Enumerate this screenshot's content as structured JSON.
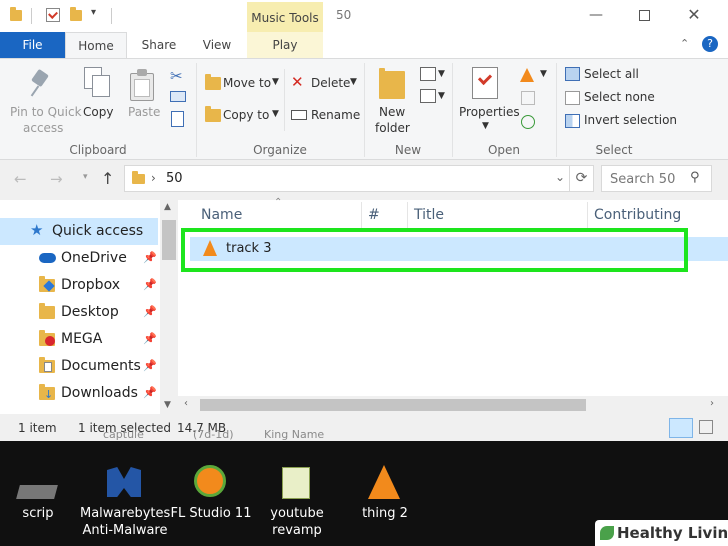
{
  "window": {
    "title": "50",
    "contextual_tab_group": "Music Tools",
    "tabs": [
      "File",
      "Home",
      "Share",
      "View",
      "Play"
    ]
  },
  "ribbon": {
    "clipboard": {
      "pin_label_line1": "Pin to Quick",
      "pin_label_line2": "access",
      "copy_label": "Copy",
      "paste_label": "Paste",
      "group_label": "Clipboard"
    },
    "organize": {
      "move_to_label": "Move to",
      "copy_to_label": "Copy to",
      "delete_label": "Delete",
      "rename_label": "Rename",
      "group_label": "Organize"
    },
    "new": {
      "new_folder_line1": "New",
      "new_folder_line2": "folder",
      "group_label": "New"
    },
    "open": {
      "properties_label": "Properties",
      "group_label": "Open"
    },
    "select": {
      "select_all_label": "Select all",
      "select_none_label": "Select none",
      "invert_selection_label": "Invert selection",
      "group_label": "Select"
    }
  },
  "address": {
    "path_segment": "50",
    "search_placeholder": "Search 50"
  },
  "nav_pane": {
    "items": [
      {
        "label": "Quick access",
        "icon": "star-icon",
        "pinned": false
      },
      {
        "label": "OneDrive",
        "icon": "cloud-icon",
        "pinned": true
      },
      {
        "label": "Dropbox",
        "icon": "dropbox-icon",
        "pinned": true
      },
      {
        "label": "Desktop",
        "icon": "folder-icon",
        "pinned": true
      },
      {
        "label": "MEGA",
        "icon": "mega-icon",
        "pinned": true
      },
      {
        "label": "Documents",
        "icon": "documents-icon",
        "pinned": true
      },
      {
        "label": "Downloads",
        "icon": "downloads-icon",
        "pinned": true
      }
    ]
  },
  "file_list": {
    "columns": [
      "Name",
      "#",
      "Title",
      "Contributing artists"
    ],
    "rows": [
      {
        "name": "track 3",
        "icon": "vlc-cone-icon",
        "selected": true
      }
    ]
  },
  "status": {
    "item_count": "1 item",
    "selection": "1 item selected",
    "size": "14.7 MB"
  },
  "desktop": {
    "ghost_labels": [
      "captule",
      "(7d-1d)",
      "King Name"
    ],
    "icons": [
      {
        "label_line1": "scrip",
        "label_line2": "",
        "icon": "scrip-icon"
      },
      {
        "label_line1": "Malwarebytes",
        "label_line2": "Anti-Malware",
        "icon": "malwarebytes-icon"
      },
      {
        "label_line1": "FL Studio 11",
        "label_line2": "",
        "icon": "fl-studio-icon"
      },
      {
        "label_line1": "youtube",
        "label_line2": "revamp",
        "icon": "text-file-icon"
      },
      {
        "label_line1": "thing 2",
        "label_line2": "",
        "icon": "vlc-cone-icon"
      }
    ]
  },
  "watermark": {
    "text": "Healthy Living"
  },
  "colors": {
    "accent_blue": "#1a66c2",
    "selection": "#cce8ff",
    "highlight_green": "#1de51d",
    "music_tools_tab": "#f7edb0",
    "folder": "#e8b64a",
    "vlc_orange": "#f28a1c"
  }
}
